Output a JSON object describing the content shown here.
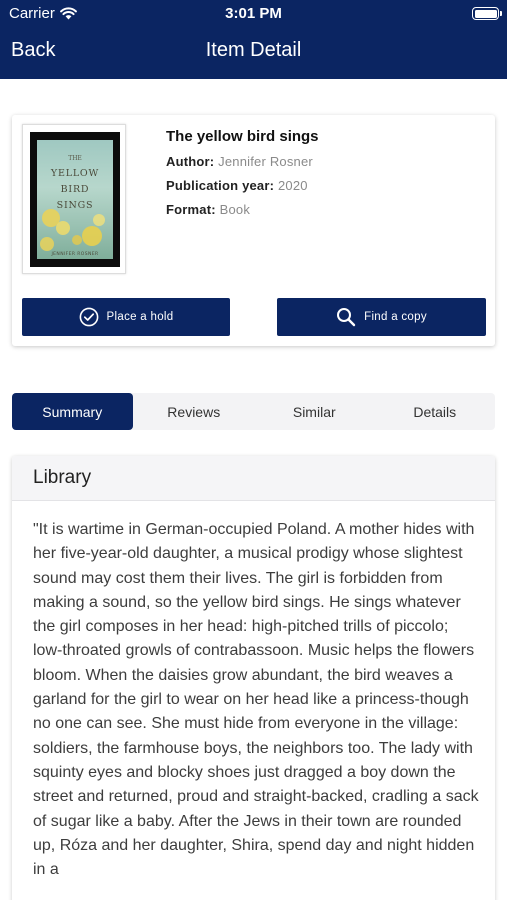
{
  "status_bar": {
    "carrier": "Carrier",
    "time": "3:01 PM"
  },
  "nav": {
    "back_label": "Back",
    "title": "Item Detail"
  },
  "item": {
    "title": "The yellow bird sings",
    "author_label": "Author:",
    "author": "Jennifer Rosner",
    "year_label": "Publication year:",
    "year": "2020",
    "format_label": "Format:",
    "format": "Book",
    "cover_title_lines": [
      "THE",
      "YELLOW",
      "BIRD",
      "SINGS"
    ],
    "cover_author": "JENNIFER ROSNER"
  },
  "actions": {
    "hold_label": "Place a hold",
    "find_label": "Find a copy"
  },
  "tabs": [
    {
      "label": "Summary",
      "active": true
    },
    {
      "label": "Reviews",
      "active": false
    },
    {
      "label": "Similar",
      "active": false
    },
    {
      "label": "Details",
      "active": false
    }
  ],
  "panel": {
    "heading": "Library",
    "summary": "\"It is wartime in German-occupied Poland. A mother hides with her five-year-old daughter, a musical prodigy whose slightest sound may cost them their lives. The girl is forbidden from making a sound, so the yellow bird sings. He sings whatever the girl composes in her head: high-pitched trills of piccolo; low-throated growls of contrabassoon. Music helps the flowers bloom. When the daisies grow abundant, the bird weaves a garland for the girl to wear on her head like a princess-though no one can see. She must hide from everyone in the village: soldiers, the farmhouse boys, the neighbors too. The lady with squinty eyes and blocky shoes just dragged a boy down the street and returned, proud and straight-backed, cradling a sack of sugar like a baby. After the Jews in their town are rounded up, Róza and her daughter, Shira, spend day and night hidden in a"
  },
  "colors": {
    "brand": "#0b2562",
    "tab_bg": "#f3f3f5",
    "muted_text": "#8a8a8a"
  }
}
